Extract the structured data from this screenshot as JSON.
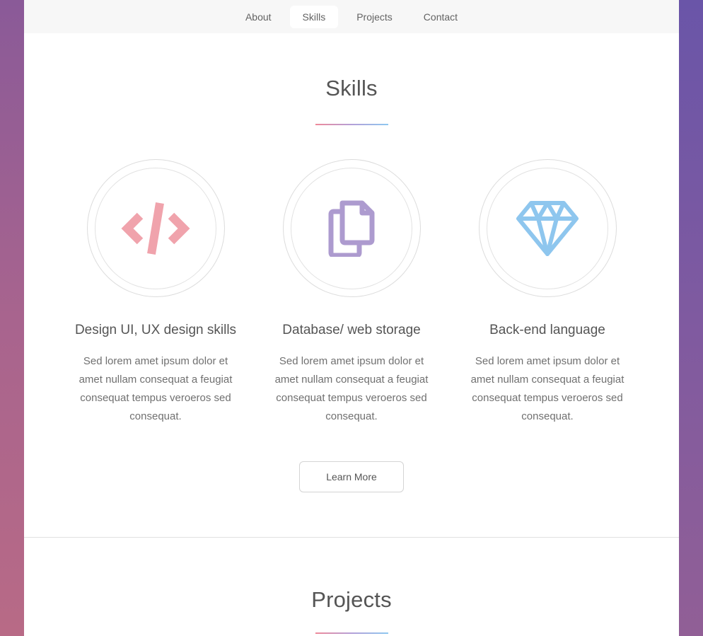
{
  "nav": {
    "items": [
      {
        "label": "About",
        "active": false
      },
      {
        "label": "Skills",
        "active": true
      },
      {
        "label": "Projects",
        "active": false
      },
      {
        "label": "Contact",
        "active": false
      }
    ]
  },
  "skills": {
    "title": "Skills",
    "features": [
      {
        "icon": "code-icon",
        "color": "#f0a3ac",
        "heading": "Design UI, UX design skills",
        "text": "Sed lorem amet ipsum dolor et amet nullam consequat a feugiat consequat tempus veroeros sed consequat."
      },
      {
        "icon": "copy-icon",
        "color": "#ad9bcf",
        "heading": "Database/ web storage",
        "text": "Sed lorem amet ipsum dolor et amet nullam consequat a feugiat consequat tempus veroeros sed consequat."
      },
      {
        "icon": "diamond-icon",
        "color": "#8ec6ee",
        "heading": "Back-end language",
        "text": "Sed lorem amet ipsum dolor et amet nullam consequat a feugiat consequat tempus veroeros sed consequat."
      }
    ],
    "button_label": "Learn More"
  },
  "projects": {
    "title": "Projects"
  }
}
